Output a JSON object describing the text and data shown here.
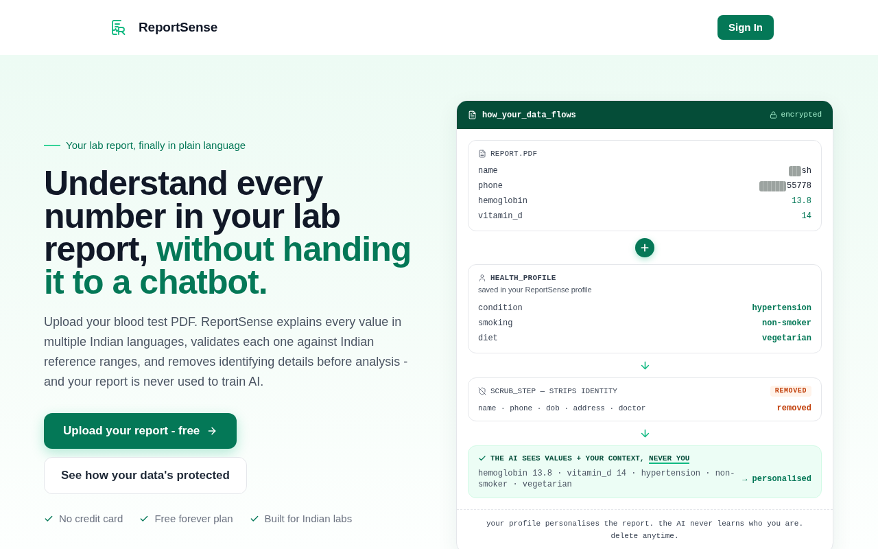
{
  "header": {
    "brand": "ReportSense",
    "sign_in": "Sign In"
  },
  "hero": {
    "eyebrow": "Your lab report, finally in plain language",
    "heading_lead": "Understand every number in your lab report,",
    "heading_highlight": "without handing it to a chatbot.",
    "description": "Upload your blood test PDF. ReportSense explains every value in multiple Indian languages, validates each one against Indian reference ranges, and removes identifying details before analysis - and your report is never used to train AI.",
    "primary_cta": "Upload your report - free",
    "secondary_cta": "See how your data's protected",
    "perks": [
      "No credit card",
      "Free forever plan",
      "Built for Indian labs"
    ]
  },
  "flow_card": {
    "title": "how_your_data_flows",
    "badge": "encrypted",
    "steps": [
      {
        "kind": "file",
        "label": "REPORT.PDF",
        "fields": [
          {
            "key": "name",
            "value": "sh",
            "kind": "masked"
          },
          {
            "key": "phone",
            "value": "55778",
            "kind": "masked"
          },
          {
            "key": "hemoglobin",
            "value": "13.8",
            "kind": "reading"
          },
          {
            "key": "vitamin_d",
            "value": "14",
            "kind": "reading"
          }
        ]
      },
      {
        "kind": "profile",
        "label": "HEALTH_PROFILE",
        "note": "saved in your ReportSense profile",
        "fields": [
          {
            "key": "condition",
            "value": "hypertension",
            "kind": "trait"
          },
          {
            "key": "smoking",
            "value": "non-smoker",
            "kind": "trait"
          },
          {
            "key": "diet",
            "value": "vegetarian",
            "kind": "trait"
          }
        ]
      },
      {
        "kind": "scrub",
        "label": "SCRUB_STEP — STRIPS IDENTITY",
        "tag": "REMOVED",
        "items": "name · phone · dob · address · doctor",
        "result": "removed"
      },
      {
        "kind": "output",
        "label": "THE AI SEES VALUES + YOUR CONTEXT,",
        "label_emphasis": "NEVER YOU",
        "items": "hemoglobin 13.8 · vitamin_d 14 · hypertension · non-smoker · vegetarian",
        "result": "→ personalised"
      }
    ],
    "footer": "your profile personalises the report. the AI never learns who you are. delete anytime."
  }
}
